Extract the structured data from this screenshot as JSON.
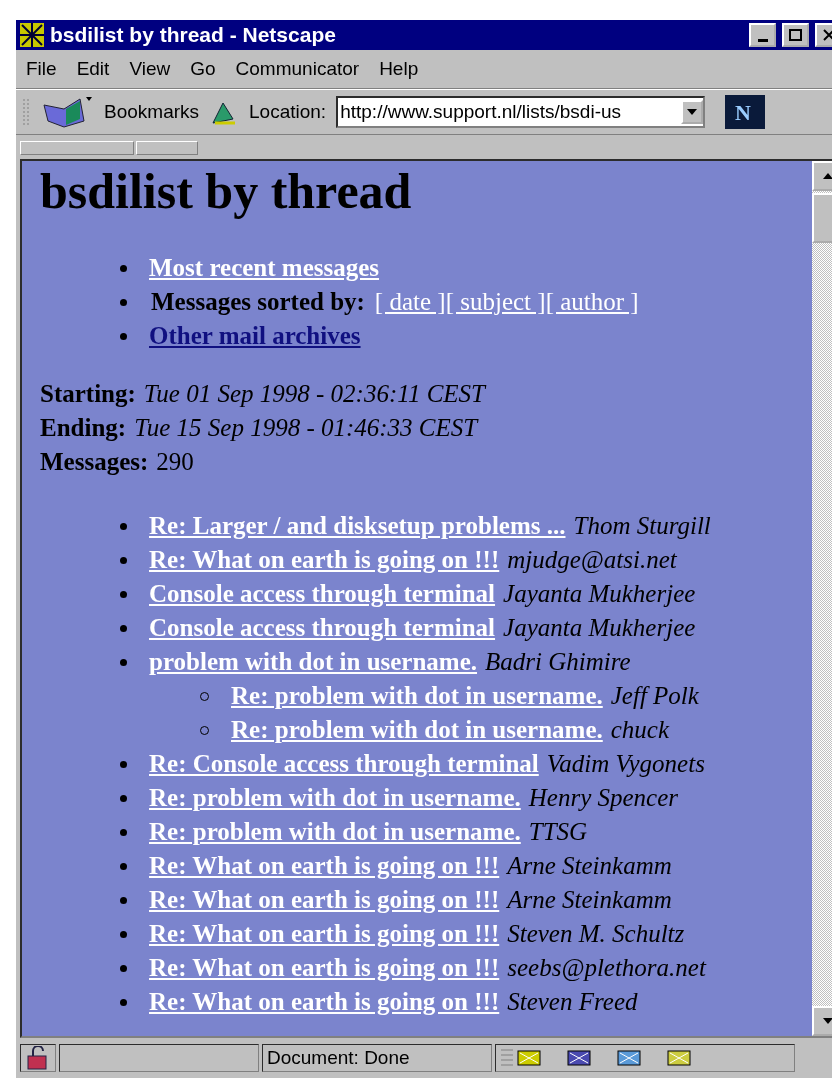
{
  "window": {
    "title": "bsdilist by thread - Netscape"
  },
  "menu": [
    "File",
    "Edit",
    "View",
    "Go",
    "Communicator",
    "Help"
  ],
  "toolbar": {
    "logo": "N",
    "bookmarks": "Bookmarks",
    "location_label": "Location:",
    "location_value": "http://www.support.nl/lists/bsdi-us"
  },
  "page": {
    "heading": "bsdilist by thread",
    "nav": [
      {
        "kind": "link",
        "text": "Most recent messages",
        "visited": true
      },
      {
        "kind": "sort",
        "label": "Messages sorted by:",
        "links": [
          "[ date ]",
          "[ subject ]",
          "[ author ]"
        ]
      },
      {
        "kind": "link",
        "text": "Other mail archives",
        "visited": false
      }
    ],
    "info": [
      {
        "label": "Starting:",
        "value": "Tue 01 Sep 1998 - 02:36:11 CEST",
        "italic": true
      },
      {
        "label": "Ending:",
        "value": "Tue 15 Sep 1998 - 01:46:33 CEST",
        "italic": true
      },
      {
        "label": "Messages:",
        "value": "290",
        "italic": false
      }
    ],
    "threads": [
      {
        "subject": "Re: Larger / and disksetup problems ...",
        "author": "Thom Sturgill"
      },
      {
        "subject": "Re: What on earth is going on !!!",
        "author": "mjudge@atsi.net"
      },
      {
        "subject": "Console access through terminal",
        "author": "Jayanta Mukherjee"
      },
      {
        "subject": "Console access through terminal",
        "author": "Jayanta Mukherjee"
      },
      {
        "subject": "problem with dot in username.",
        "author": "Badri Ghimire",
        "children": [
          {
            "subject": "Re: problem with dot in username.",
            "author": "Jeff Polk"
          },
          {
            "subject": "Re: problem with dot in username.",
            "author": "chuck"
          }
        ]
      },
      {
        "subject": "Re: Console access through terminal",
        "author": "Vadim Vygonets"
      },
      {
        "subject": "Re: problem with dot in username.",
        "author": "Henry Spencer"
      },
      {
        "subject": "Re: problem with dot in username.",
        "author": "TTSG"
      },
      {
        "subject": "Re: What on earth is going on !!!",
        "author": "Arne Steinkamm"
      },
      {
        "subject": "Re: What on earth is going on !!!",
        "author": "Arne Steinkamm"
      },
      {
        "subject": "Re: What on earth is going on !!!",
        "author": "Steven M. Schultz"
      },
      {
        "subject": "Re: What on earth is going on !!!",
        "author": "seebs@plethora.net"
      },
      {
        "subject": "Re: What on earth is going on !!!",
        "author": "Steven Freed"
      }
    ]
  },
  "status_bar": {
    "text": "Document: Done"
  }
}
